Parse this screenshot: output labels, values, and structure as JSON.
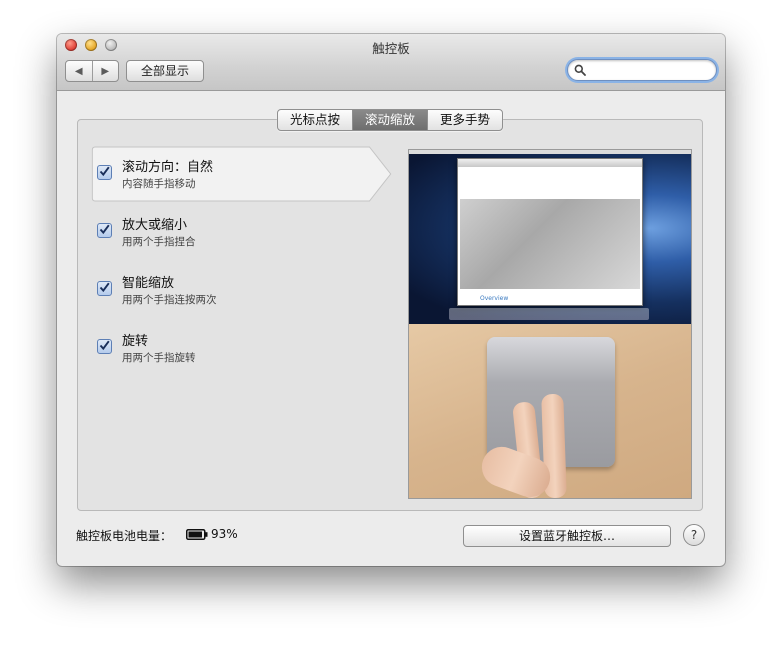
{
  "window": {
    "title": "触控板"
  },
  "toolbar": {
    "back_icon": "chevron-left-icon",
    "forward_icon": "chevron-right-icon",
    "show_all_label": "全部显示",
    "search_placeholder": "",
    "search_value": ""
  },
  "tabs": [
    {
      "label": "光标点按",
      "active": false
    },
    {
      "label": "滚动缩放",
      "active": true
    },
    {
      "label": "更多手势",
      "active": false
    }
  ],
  "options": [
    {
      "title": "滚动方向：自然",
      "subtitle": "内容随手指移动",
      "checked": true,
      "selected": true
    },
    {
      "title": "放大或缩小",
      "subtitle": "用两个手指捏合",
      "checked": true,
      "selected": false
    },
    {
      "title": "智能缩放",
      "subtitle": "用两个手指连按两次",
      "checked": true,
      "selected": false
    },
    {
      "title": "旋转",
      "subtitle": "用两个手指旋转",
      "checked": true,
      "selected": false
    }
  ],
  "preview": {
    "doc_heading": "Overview"
  },
  "footer": {
    "battery_label": "触控板电池电量：",
    "battery_value": "93%",
    "battery_fraction": 0.93,
    "setup_button_label": "设置蓝牙触控板…",
    "help_label": "?"
  },
  "colors": {
    "active_tab": "#7b7b7b",
    "checkbox": "#b4cbec",
    "search_focus": "#8ab3e6"
  }
}
